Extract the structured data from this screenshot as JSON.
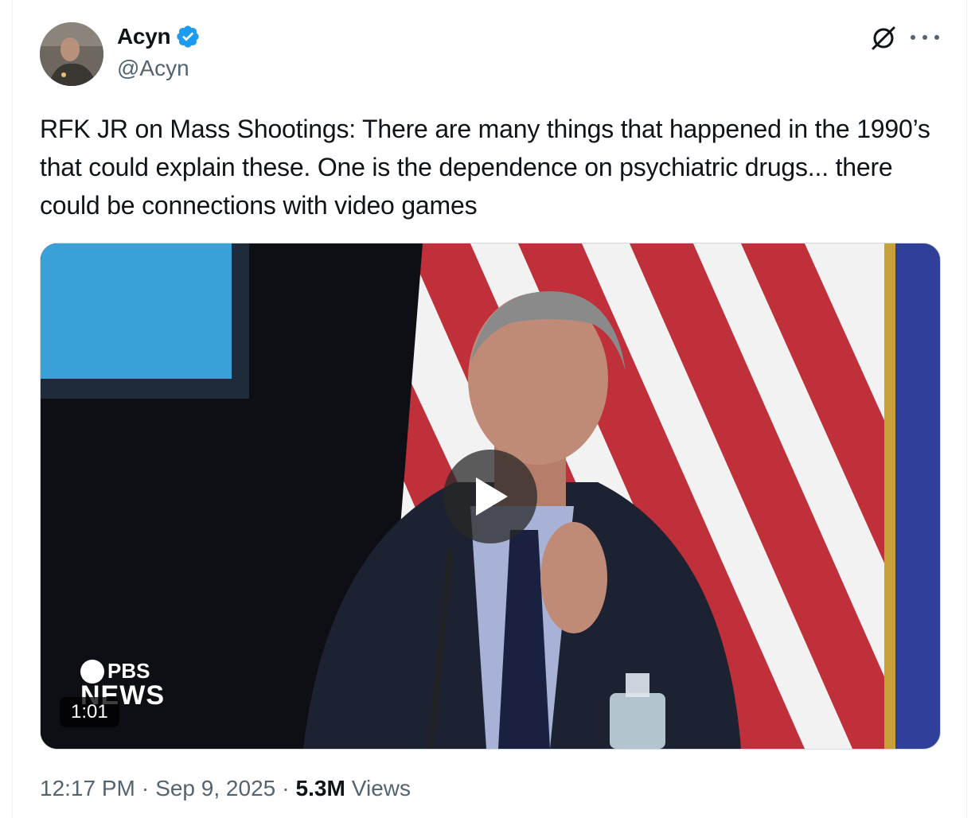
{
  "author": {
    "display_name": "Acyn",
    "handle": "@Acyn",
    "verified": true
  },
  "icons": {
    "avatar": "avatar",
    "verified": "verified-badge-icon",
    "grok": "grok-icon",
    "more": "more-options-icon",
    "play": "play-icon"
  },
  "tweet": {
    "text": "RFK JR on Mass Shootings: There are many things that happened in the 1990’s that could explain these. One is the dependence on psychiatric drugs... there could be connections with video games"
  },
  "video": {
    "duration": "1:01",
    "watermark_top": "PBS",
    "watermark_bottom": "NEWS"
  },
  "meta": {
    "time": "12:17 PM",
    "separator": "·",
    "date": "Sep 9, 2025",
    "views_count": "5.3M",
    "views_label": "Views"
  },
  "colors": {
    "text_primary": "#0f1419",
    "text_secondary": "#536471",
    "verified_blue": "#1d9bf0",
    "border": "#cfd9de"
  }
}
